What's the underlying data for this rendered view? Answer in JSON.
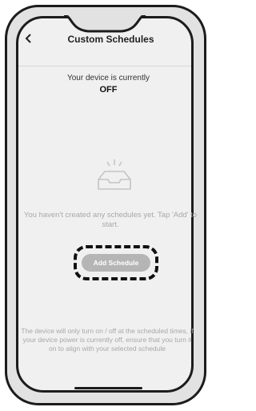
{
  "header": {
    "title": "Custom Schedules",
    "back_icon": "chevron-left-icon"
  },
  "status": {
    "label": "Your device is currently",
    "value": "OFF"
  },
  "empty_state": {
    "icon": "inbox-tray-icon",
    "message": "You haven't created any schedules yet. Tap 'Add' to start."
  },
  "actions": {
    "add_schedule_label": "Add Schedule"
  },
  "footer": {
    "note": "The device will only turn on / off at the scheduled times, if your device power is currently off, ensure that you turn it on to align with your selected schedule"
  },
  "colors": {
    "button": "#b5b5b5",
    "muted_text": "#a8a8a8",
    "frame": "#1c1c1c",
    "screen": "#f0f0f0"
  }
}
